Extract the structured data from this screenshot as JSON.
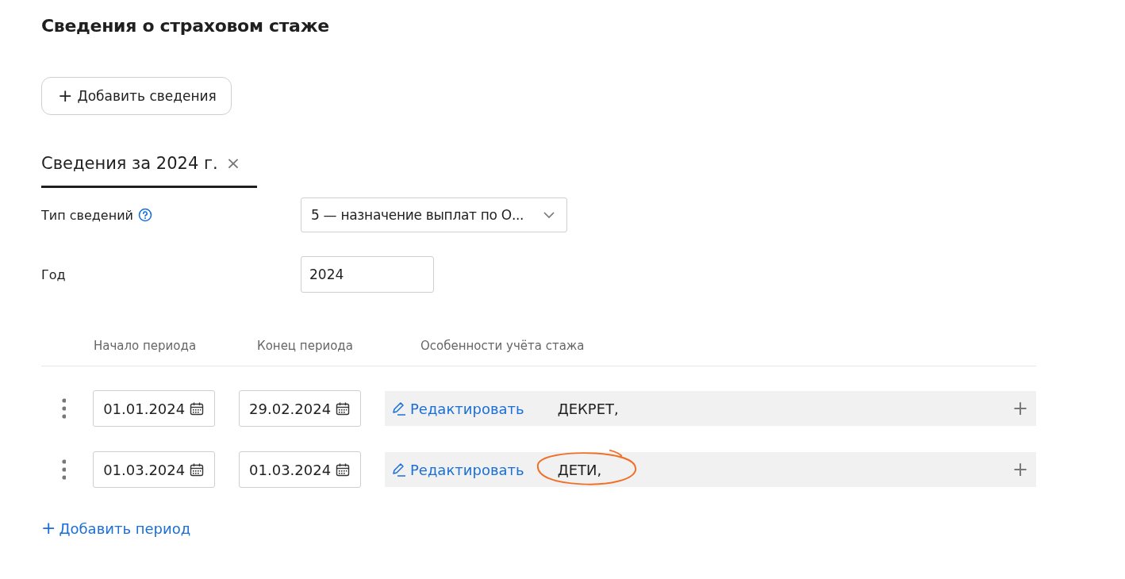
{
  "title": "Сведения о страховом стаже",
  "add_button": {
    "icon": "+",
    "label": "Добавить сведения"
  },
  "tabs": [
    {
      "label": "Сведения за 2024 г.",
      "close": "×",
      "selected": true
    }
  ],
  "fields": [
    {
      "kind": "select",
      "label": "Тип сведений",
      "help": true,
      "value": "5 — назначение выплат по О..."
    },
    {
      "kind": "input",
      "label": "Год",
      "help": false,
      "value": "2024"
    }
  ],
  "table": {
    "columns": [
      "Начало периода",
      "Конец периода",
      "Особенности учёта стажа"
    ],
    "rows": [
      {
        "start": "01.01.2024",
        "end": "29.02.2024",
        "edit": "Редактировать",
        "features": "ДЕКРЕТ,",
        "add": "+",
        "annotated": false
      },
      {
        "start": "01.03.2024",
        "end": "01.03.2024",
        "edit": "Редактировать",
        "features": "ДЕТИ,",
        "add": "+",
        "annotated": true
      }
    ]
  },
  "add_period": {
    "icon": "+",
    "label": "Добавить период"
  }
}
